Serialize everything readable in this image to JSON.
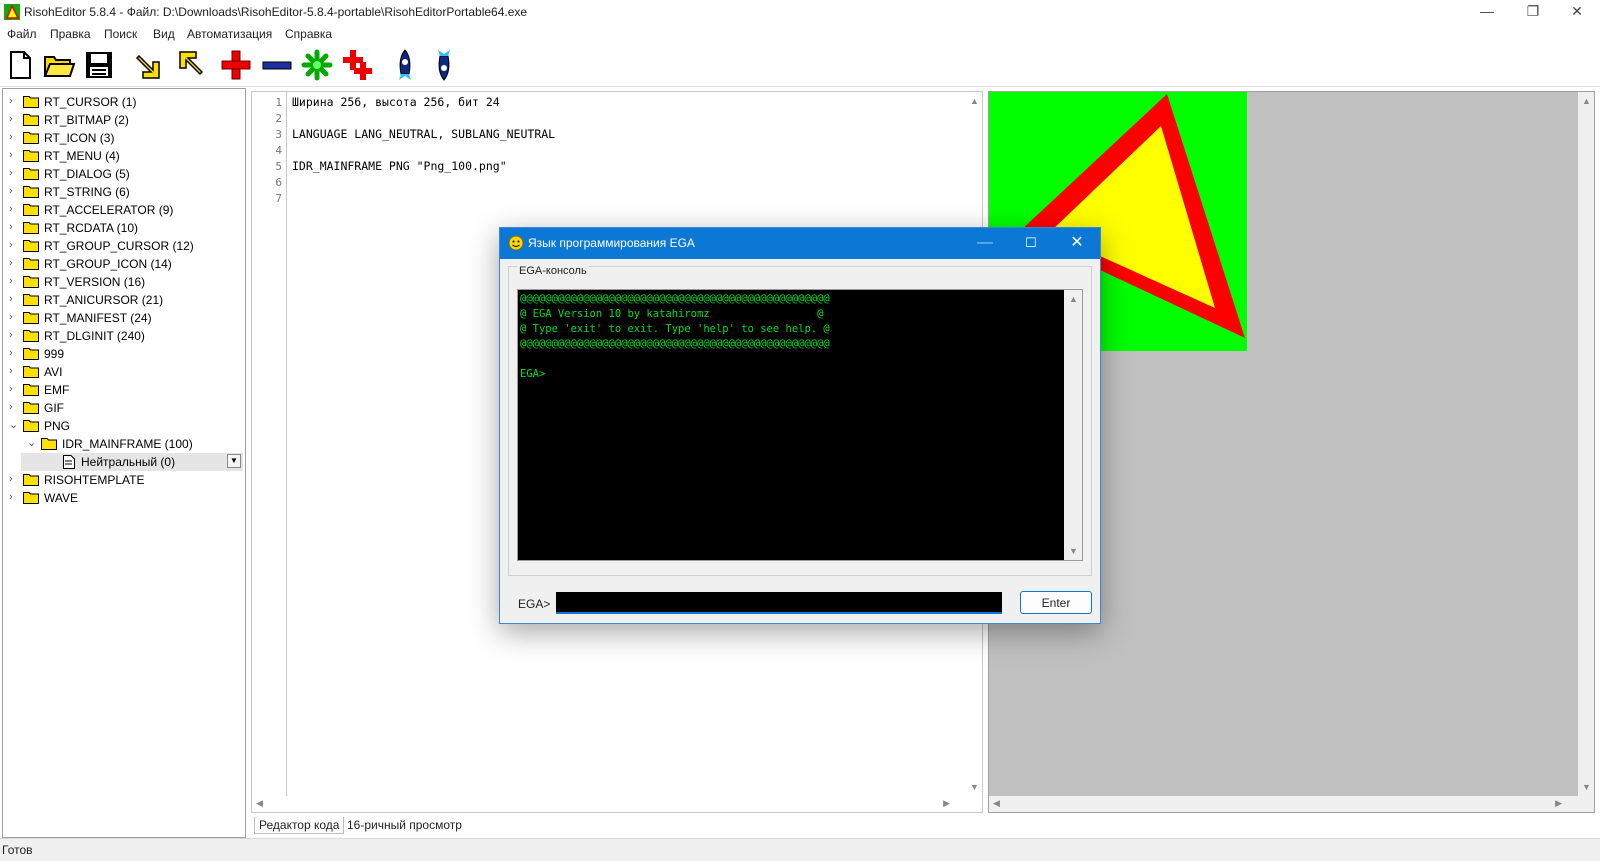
{
  "window": {
    "title": "RisohEditor 5.8.4 - Файл: D:\\Downloads\\RisohEditor-5.8.4-portable\\RisohEditorPortable64.exe",
    "minimize": "—",
    "maximize": "❐",
    "close": "✕"
  },
  "menu": [
    "Файл",
    "Правка",
    "Поиск",
    "Вид",
    "Автоматизация",
    "Справка"
  ],
  "toolbar_icons": [
    "new-file-icon",
    "open-folder-icon",
    "save-icon",
    "import-arrow-icon",
    "export-arrow-icon",
    "add-resource-icon",
    "delete-resource-icon",
    "clone-resource-icon",
    "copy-resource-icon",
    "rocket-up-icon",
    "rocket-down-icon"
  ],
  "tree": {
    "items": [
      {
        "label": "RT_CURSOR (1)"
      },
      {
        "label": "RT_BITMAP (2)"
      },
      {
        "label": "RT_ICON (3)"
      },
      {
        "label": "RT_MENU (4)"
      },
      {
        "label": "RT_DIALOG (5)"
      },
      {
        "label": "RT_STRING (6)"
      },
      {
        "label": "RT_ACCELERATOR (9)"
      },
      {
        "label": "RT_RCDATA (10)"
      },
      {
        "label": "RT_GROUP_CURSOR (12)"
      },
      {
        "label": "RT_GROUP_ICON (14)"
      },
      {
        "label": "RT_VERSION (16)"
      },
      {
        "label": "RT_ANICURSOR (21)"
      },
      {
        "label": "RT_MANIFEST (24)"
      },
      {
        "label": "RT_DLGINIT (240)"
      },
      {
        "label": "999"
      },
      {
        "label": "AVI"
      },
      {
        "label": "EMF"
      },
      {
        "label": "GIF"
      },
      {
        "label": "PNG"
      }
    ],
    "png_child": "IDR_MAINFRAME (100)",
    "language_item": "Нейтральный (0)",
    "after_items": [
      {
        "label": "RISOHTEMPLATE"
      },
      {
        "label": "WAVE"
      }
    ]
  },
  "editor": {
    "line_numbers": [
      "1",
      "2",
      "3",
      "4",
      "5",
      "6",
      "7"
    ],
    "lines": [
      "Ширина 256, высота 256, бит 24",
      "",
      "LANGUAGE LANG_NEUTRAL, SUBLANG_NEUTRAL",
      "",
      "IDR_MAINFRAME PNG \"Png_100.png\"",
      "",
      ""
    ]
  },
  "tabs": {
    "code": "Редактор кода",
    "hex": "16-ричный просмотр"
  },
  "preview": {
    "background_color": "#00ff00",
    "triangle_fill": "#ffff00",
    "triangle_border": "#ff0000"
  },
  "status": {
    "text": "Готов"
  },
  "dialog": {
    "title": "Язык программирования EGA",
    "group_label": "EGA-консоль",
    "console_lines": [
      "@@@@@@@@@@@@@@@@@@@@@@@@@@@@@@@@@@@@@@@@@@@@@@@@@",
      "@ EGA Version 10 by katahiromz                 @",
      "@ Type 'exit' to exit. Type 'help' to see help. @",
      "@@@@@@@@@@@@@@@@@@@@@@@@@@@@@@@@@@@@@@@@@@@@@@@@@",
      "",
      "EGA>"
    ],
    "prompt_label": "EGA>",
    "input_value": "",
    "enter_label": "Enter",
    "console_text_color": "#00dd22"
  }
}
